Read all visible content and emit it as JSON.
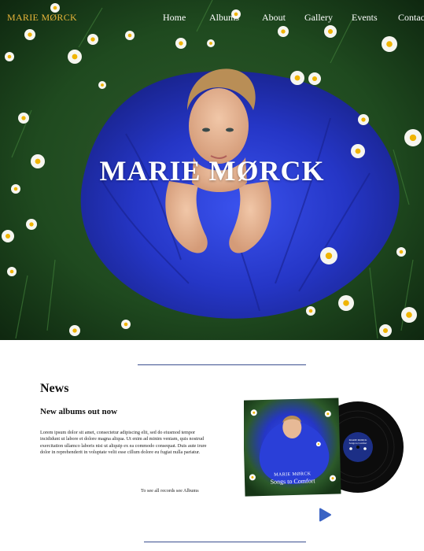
{
  "brand": "MARIE MØRCK",
  "nav": {
    "items": [
      {
        "label": "Home"
      },
      {
        "label": "Albums"
      },
      {
        "label": "About"
      },
      {
        "label": "Gallery"
      },
      {
        "label": "Events"
      },
      {
        "label": "Contac"
      }
    ]
  },
  "hero": {
    "title": "MARIE MØRCK"
  },
  "news": {
    "heading": "News",
    "subheading": "New albums out now",
    "body": "Lorem ipsum dolor sit amet, consectetur adipiscing elit, sed do eiusmod tempor incididunt ut labore et dolore magna aliqua. Ut enim ad minim veniam, quis nostrud exercitation ullamco laboris nisi ut aliquip ex ea commodo consequat. Duis aute irure dolor in reprehenderit in voluptate velit esse cillum dolore eu fugiat nulla pariatur.",
    "link": "To see all records see Albums"
  },
  "album": {
    "artist": "MARIE MØRCK",
    "title": "Songs to Comfort",
    "label_line1": "MARIE MØRCK",
    "label_line2": "Songs to Comfort"
  },
  "icons": {
    "play": "play-icon"
  },
  "colors": {
    "brand": "#e8b53a",
    "accent": "#3b4f8f",
    "play": "#3a63c4",
    "dress": "#2b3fd6"
  }
}
